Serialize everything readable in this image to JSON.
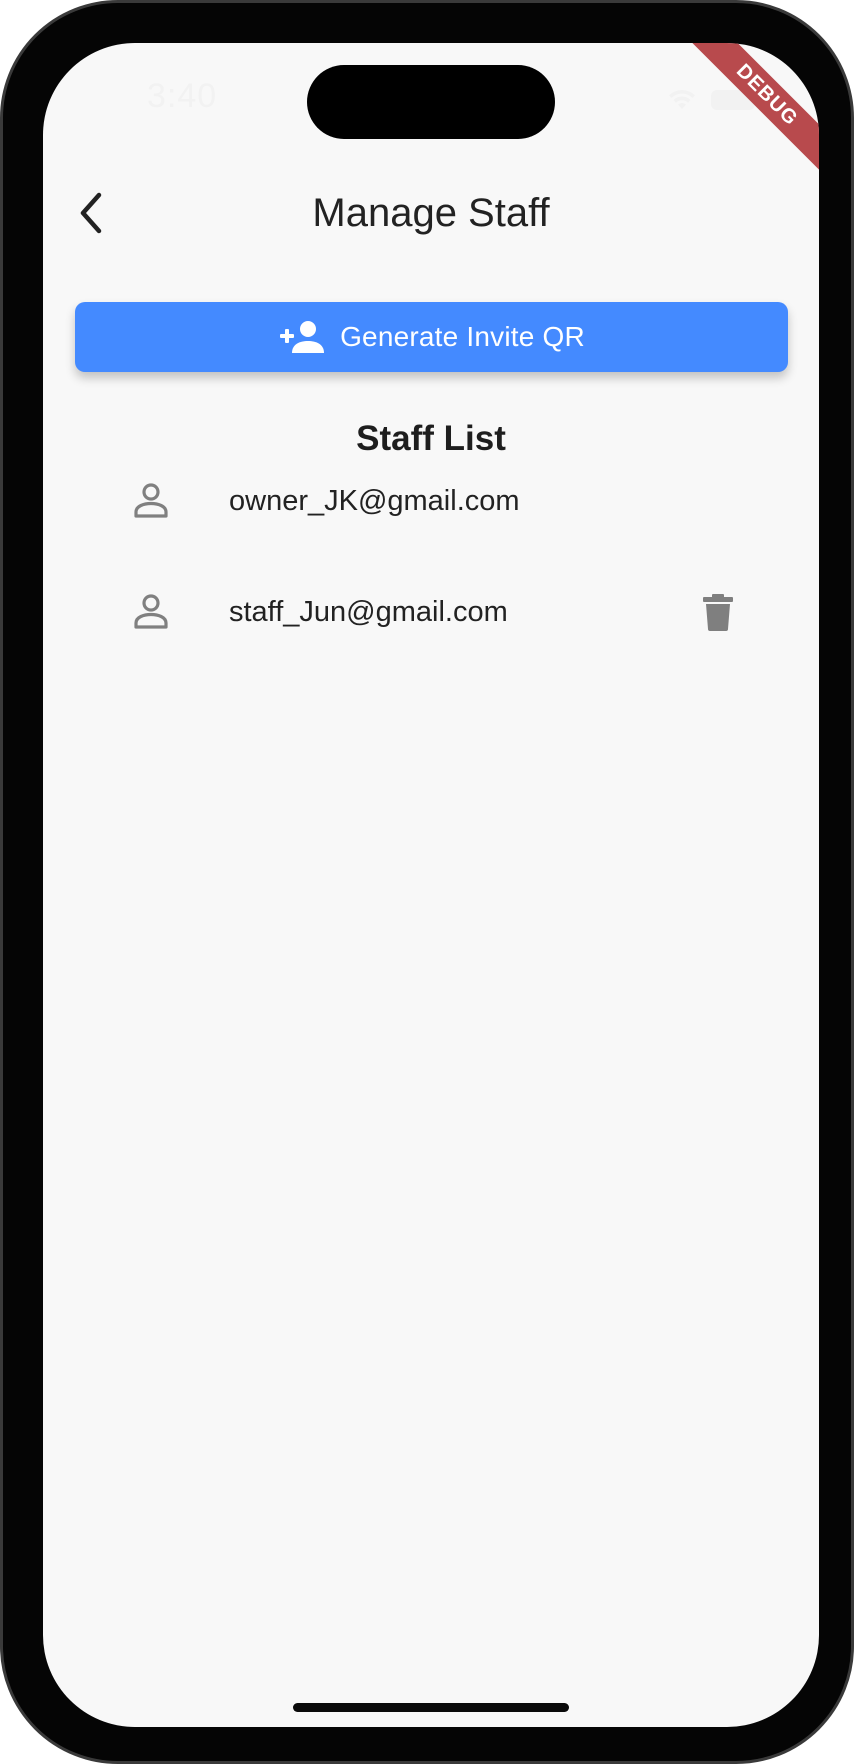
{
  "status_bar": {
    "time": "3:40"
  },
  "debug_banner": "DEBUG",
  "header": {
    "title": "Manage Staff"
  },
  "invite_button": {
    "label": "Generate Invite QR",
    "icon": "person-add-icon",
    "color": "#448aff"
  },
  "staff_list": {
    "heading": "Staff List",
    "items": [
      {
        "email": "owner_JK@gmail.com",
        "icon": "person-outline-icon",
        "deletable": false
      },
      {
        "email": "staff_Jun@gmail.com",
        "icon": "person-outline-icon",
        "deletable": true
      }
    ]
  }
}
